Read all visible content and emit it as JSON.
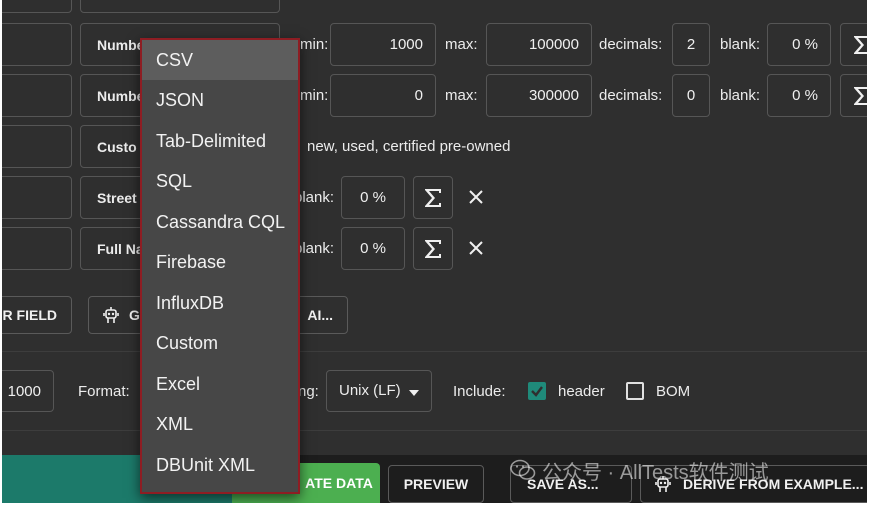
{
  "rows": [
    {
      "type": "Numbe",
      "min_label": "min:",
      "min": "1000",
      "max_label": "max:",
      "max": "100000",
      "decimals_label": "decimals:",
      "decimals": "2",
      "blank_label": "blank:",
      "blank": "0 %"
    },
    {
      "type": "Numbe",
      "min_label": "min:",
      "min": "0",
      "max_label": "max:",
      "max": "300000",
      "decimals_label": "decimals:",
      "decimals": "0",
      "blank_label": "blank:",
      "blank": "0 %"
    },
    {
      "type": "Custo",
      "values": "new, used, certified pre-owned"
    },
    {
      "type": "Street",
      "blank_label": "blank:",
      "blank": "0 %"
    },
    {
      "type": "Full Na",
      "blank_label": "blank:",
      "blank": "0 %"
    }
  ],
  "actions": {
    "add_field": "R FIELD",
    "generate_fields": "G",
    "ai": "AI..."
  },
  "options": {
    "rows_value": "1000",
    "format_label": "Format:",
    "line_ending_label": "ng:",
    "line_ending_value": "Unix (LF)",
    "include_label": "Include:",
    "header_label": "header",
    "header_checked": true,
    "bom_label": "BOM",
    "bom_checked": false
  },
  "footer": {
    "generate": "ATE DATA",
    "preview": "PREVIEW",
    "save_as": "SAVE AS...",
    "derive": "DERIVE FROM EXAMPLE..."
  },
  "format_menu": {
    "selected": "CSV",
    "items": [
      "CSV",
      "JSON",
      "Tab-Delimited",
      "SQL",
      "Cassandra CQL",
      "Firebase",
      "InfluxDB",
      "Custom",
      "Excel",
      "XML",
      "DBUnit XML"
    ]
  },
  "watermark": "公众号 · AllTests软件测试",
  "colors": {
    "background": "#2f2f2f",
    "accent_green": "#4caf50",
    "teal": "#1c7a6a",
    "checkbox_teal": "#1f8a7a",
    "menu_border": "#8e1d23"
  },
  "icons": [
    "sigma-icon",
    "close-icon",
    "chevron-down-icon",
    "robot-icon",
    "check-icon",
    "wechat-icon"
  ]
}
